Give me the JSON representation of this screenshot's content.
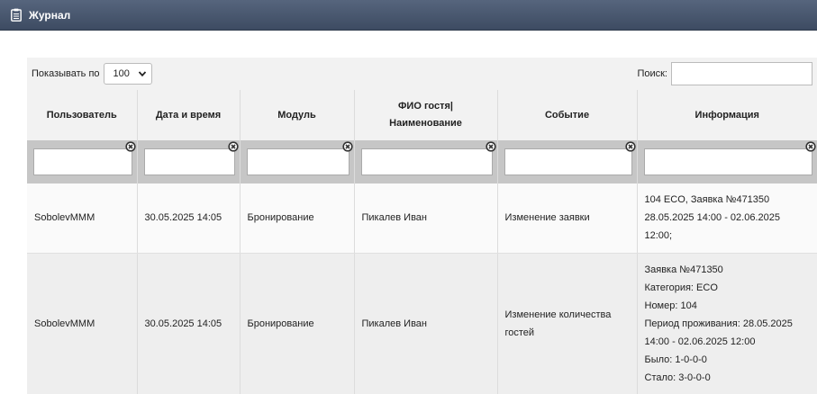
{
  "header": {
    "title": "Журнал"
  },
  "toolbar": {
    "show_label": "Показывать по",
    "page_size": "100",
    "search_label": "Поиск:",
    "search_value": ""
  },
  "table": {
    "columns": [
      "Пользователь",
      "Дата и время",
      "Модуль",
      "ФИО гостя|",
      "Событие",
      "Информация"
    ],
    "column4_line2": "Наименование",
    "rows": [
      {
        "user": "SobolevMMM",
        "datetime": "30.05.2025 14:05",
        "module": "Бронирование",
        "guest": "Пикалев Иван",
        "event": "Изменение заявки",
        "info": [
          "104 ECO, Заявка №471350",
          "28.05.2025 14:00 - 02.06.2025",
          "12:00;"
        ]
      },
      {
        "user": "SobolevMMM",
        "datetime": "30.05.2025 14:05",
        "module": "Бронирование",
        "guest": "Пикалев Иван",
        "event_line1": "Изменение количества",
        "event_line2": "гостей",
        "info": [
          "Заявка №471350",
          "Категория: ECO",
          "Номер: 104",
          "Период проживания: 28.05.2025",
          "14:00 - 02.06.2025 12:00",
          "Было: 1-0-0-0",
          "Стало: 3-0-0-0"
        ]
      }
    ]
  },
  "icons": {
    "title_icon": "clipboard-icon",
    "select_icon": "chevron-down-icon",
    "filter_clear_icon": "clear-filter-icon"
  },
  "colors": {
    "titlebar": "#46546b",
    "header_bg": "#f2f2f2",
    "filter_bg": "#c6c6c6"
  }
}
